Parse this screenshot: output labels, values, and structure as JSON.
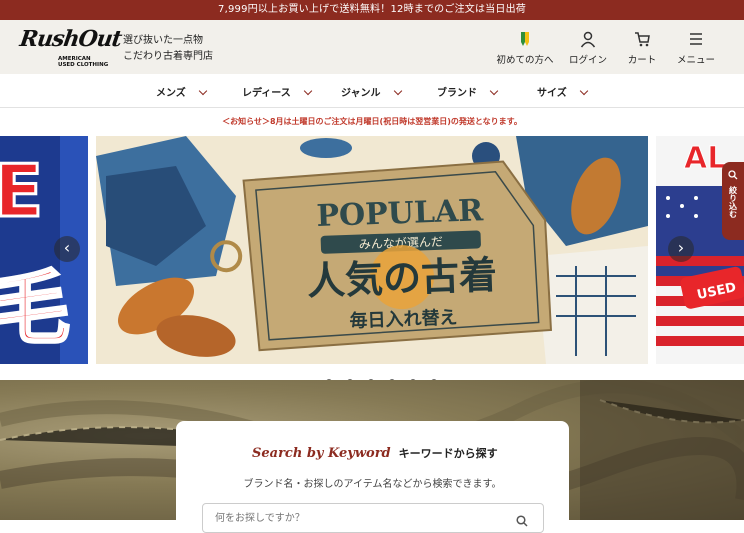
{
  "topbar": {
    "text": "7,999円以上お買い上げで送料無料！12時までのご注文は当日出荷"
  },
  "logo": {
    "script": "RushOut",
    "sub1": "AMERICAN",
    "sub2": "USED CLOTHING"
  },
  "tagline": {
    "line1": "選び抜いた一点物",
    "line2": "こだわり古着専門店"
  },
  "header_nav": [
    {
      "label": "初めての方へ",
      "icon": "leaf-icon"
    },
    {
      "label": "ログイン",
      "icon": "user-icon"
    },
    {
      "label": "カート",
      "icon": "cart-icon"
    },
    {
      "label": "メニュー",
      "icon": "menu-icon"
    }
  ],
  "categories": [
    {
      "label": "メンズ"
    },
    {
      "label": "レディース"
    },
    {
      "label": "ジャンル"
    },
    {
      "label": "ブランド"
    },
    {
      "label": "サイズ"
    }
  ],
  "notice": "＜お知らせ＞8月は土曜日のご注文は月曜日(祝日時は翌営業日)の発送となります。",
  "banner": {
    "main_en": "POPULAR",
    "ribbon": "みんなが選んだ",
    "main_jp": "人気の古着",
    "sub_jp": "毎日入れ替え",
    "left_text": "E\n毛",
    "right_text1": "AL",
    "right_text2": "USED"
  },
  "filter_tab": {
    "label": "絞り込む"
  },
  "carousel": {
    "dot_count": 6,
    "active_index": 0
  },
  "search": {
    "title_en": "Search by Keyword",
    "title_jp": "キーワードから探す",
    "subtitle": "ブランド名・お探しのアイテム名などから検索できます。",
    "placeholder": "何をお探しですか？"
  },
  "colors": {
    "brand": "#8c2b20",
    "notice": "#c0392b",
    "header_bg": "#f2f0eb"
  }
}
